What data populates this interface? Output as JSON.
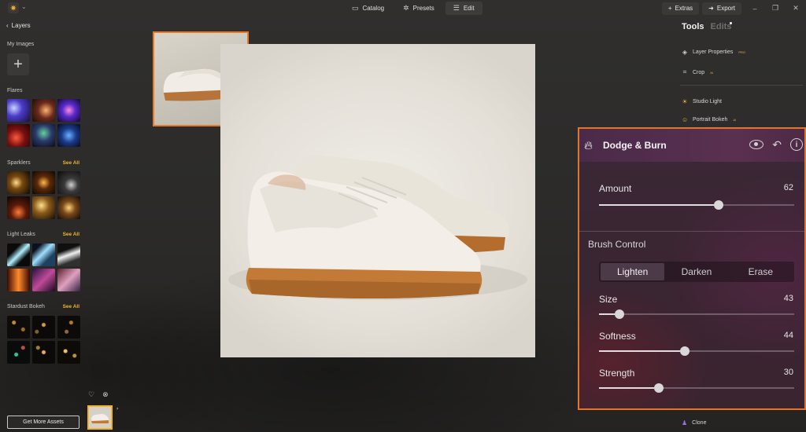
{
  "topbar": {
    "nav": [
      {
        "label": "Catalog",
        "icon": "catalog-icon"
      },
      {
        "label": "Presets",
        "icon": "presets-icon"
      },
      {
        "label": "Edit",
        "icon": "edit-icon",
        "active": true
      }
    ],
    "extras_label": "Extras",
    "export_label": "Export"
  },
  "left": {
    "back_label": "Layers",
    "my_images": "My Images",
    "sections": [
      {
        "title": "Flares",
        "see_all": ""
      },
      {
        "title": "Sparklers",
        "see_all": "See All"
      },
      {
        "title": "Light Leaks",
        "see_all": "See All"
      },
      {
        "title": "Stardust Bokeh",
        "see_all": "See All"
      }
    ],
    "get_more": "Get More Assets"
  },
  "right": {
    "tab_tools": "Tools",
    "tab_edits": "Edits",
    "tools": [
      {
        "label": "Layer Properties",
        "badge": "PRO",
        "icon": "layers-icon"
      },
      {
        "label": "Crop",
        "badge": "AI",
        "icon": "crop-icon"
      },
      {
        "label": "Studio Light",
        "badge": "",
        "icon": "studio-light-icon"
      },
      {
        "label": "Portrait Bokeh",
        "badge": "AI",
        "icon": "portrait-bokeh-icon"
      }
    ],
    "clone_label": "Clone"
  },
  "panel": {
    "title": "Dodge & Burn",
    "amount_label": "Amount",
    "amount_value": "62",
    "brush_control": "Brush Control",
    "modes": [
      "Lighten",
      "Darken",
      "Erase"
    ],
    "active_mode": "Lighten",
    "size_label": "Size",
    "size_value": "43",
    "softness_label": "Softness",
    "softness_value": "44",
    "strength_label": "Strength",
    "strength_value": "30"
  },
  "colors": {
    "accent_orange": "#e3752b",
    "see_all_yellow": "#f0b22a"
  }
}
